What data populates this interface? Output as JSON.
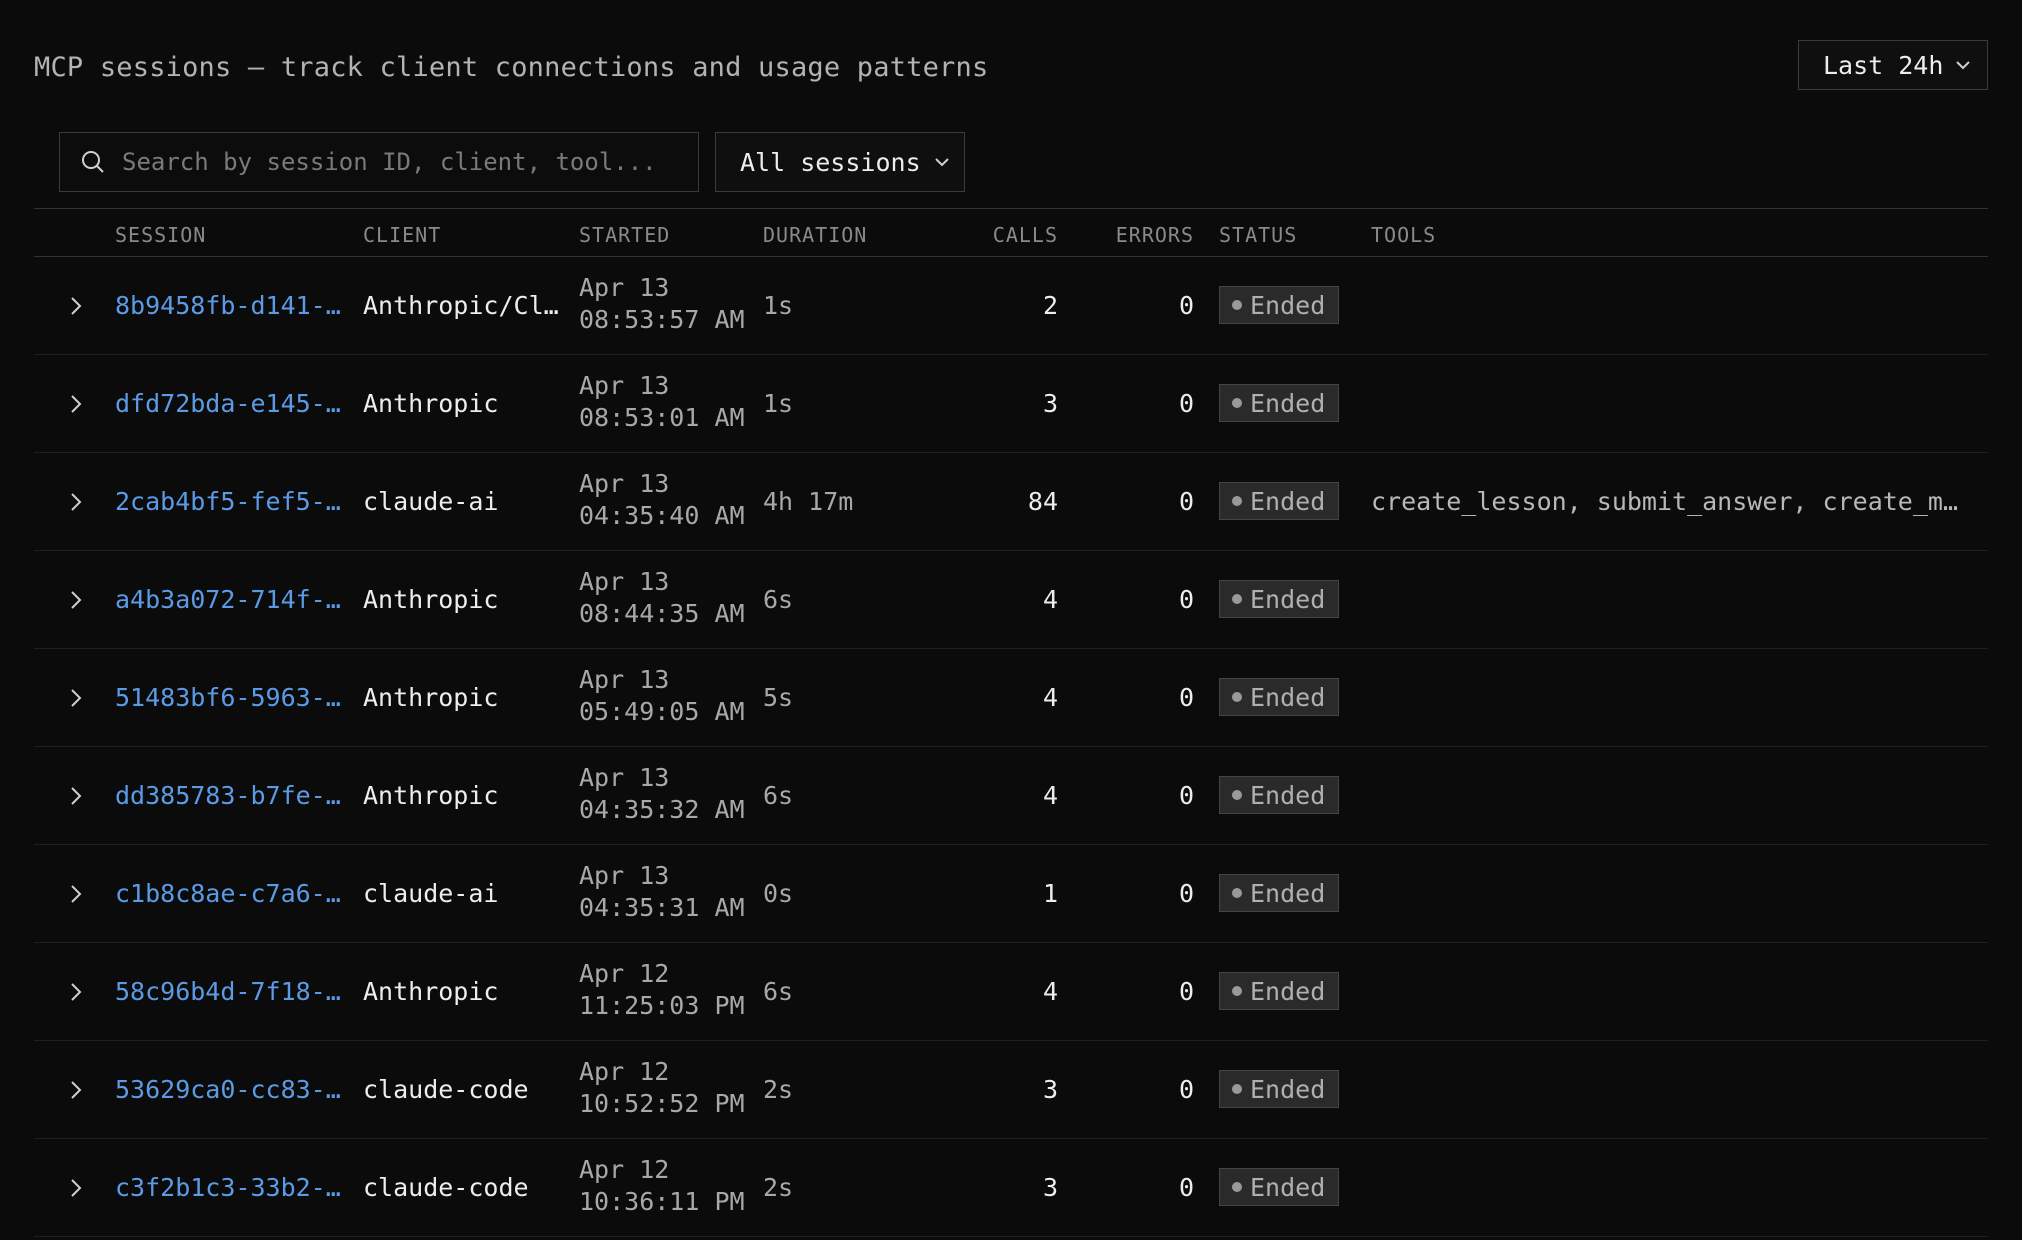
{
  "header": {
    "title": "MCP sessions — track client connections and usage patterns",
    "range_select": {
      "value": "Last 24h",
      "icon": "chevron-down-icon"
    }
  },
  "filters": {
    "search": {
      "placeholder": "Search by session ID, client, tool...",
      "value": "",
      "icon": "search-icon"
    },
    "session_filter": {
      "value": "All sessions",
      "icon": "chevron-down-icon"
    }
  },
  "table": {
    "columns": [
      "SESSION",
      "CLIENT",
      "STARTED",
      "DURATION",
      "CALLS",
      "ERRORS",
      "STATUS",
      "TOOLS"
    ],
    "rows": [
      {
        "session": "8b9458fb-d141-…",
        "client": "Anthropic/Cl…",
        "date": "Apr 13",
        "time": "08:53:57 AM",
        "duration": "1s",
        "calls": "2",
        "errors": "0",
        "status": "Ended",
        "tools": ""
      },
      {
        "session": "dfd72bda-e145-…",
        "client": "Anthropic",
        "date": "Apr 13",
        "time": "08:53:01 AM",
        "duration": "1s",
        "calls": "3",
        "errors": "0",
        "status": "Ended",
        "tools": ""
      },
      {
        "session": "2cab4bf5-fef5-…",
        "client": "claude-ai",
        "date": "Apr 13",
        "time": "04:35:40 AM",
        "duration": "4h 17m",
        "calls": "84",
        "errors": "0",
        "status": "Ended",
        "tools": "create_lesson, submit_answer, create_mu…"
      },
      {
        "session": "a4b3a072-714f-…",
        "client": "Anthropic",
        "date": "Apr 13",
        "time": "08:44:35 AM",
        "duration": "6s",
        "calls": "4",
        "errors": "0",
        "status": "Ended",
        "tools": ""
      },
      {
        "session": "51483bf6-5963-…",
        "client": "Anthropic",
        "date": "Apr 13",
        "time": "05:49:05 AM",
        "duration": "5s",
        "calls": "4",
        "errors": "0",
        "status": "Ended",
        "tools": ""
      },
      {
        "session": "dd385783-b7fe-…",
        "client": "Anthropic",
        "date": "Apr 13",
        "time": "04:35:32 AM",
        "duration": "6s",
        "calls": "4",
        "errors": "0",
        "status": "Ended",
        "tools": ""
      },
      {
        "session": "c1b8c8ae-c7a6-…",
        "client": "claude-ai",
        "date": "Apr 13",
        "time": "04:35:31 AM",
        "duration": "0s",
        "calls": "1",
        "errors": "0",
        "status": "Ended",
        "tools": ""
      },
      {
        "session": "58c96b4d-7f18-…",
        "client": "Anthropic",
        "date": "Apr 12",
        "time": "11:25:03 PM",
        "duration": "6s",
        "calls": "4",
        "errors": "0",
        "status": "Ended",
        "tools": ""
      },
      {
        "session": "53629ca0-cc83-…",
        "client": "claude-code",
        "date": "Apr 12",
        "time": "10:52:52 PM",
        "duration": "2s",
        "calls": "3",
        "errors": "0",
        "status": "Ended",
        "tools": ""
      },
      {
        "session": "c3f2b1c3-33b2-…",
        "client": "claude-code",
        "date": "Apr 12",
        "time": "10:36:11 PM",
        "duration": "2s",
        "calls": "3",
        "errors": "0",
        "status": "Ended",
        "tools": ""
      }
    ],
    "row_icon": "chevron-right-icon",
    "status_icon": "status-dot-icon"
  },
  "colors": {
    "background": "#0b0b0b",
    "session_link": "#5b9be6",
    "border": "#333333",
    "badge_bg": "#2a2a2a"
  }
}
